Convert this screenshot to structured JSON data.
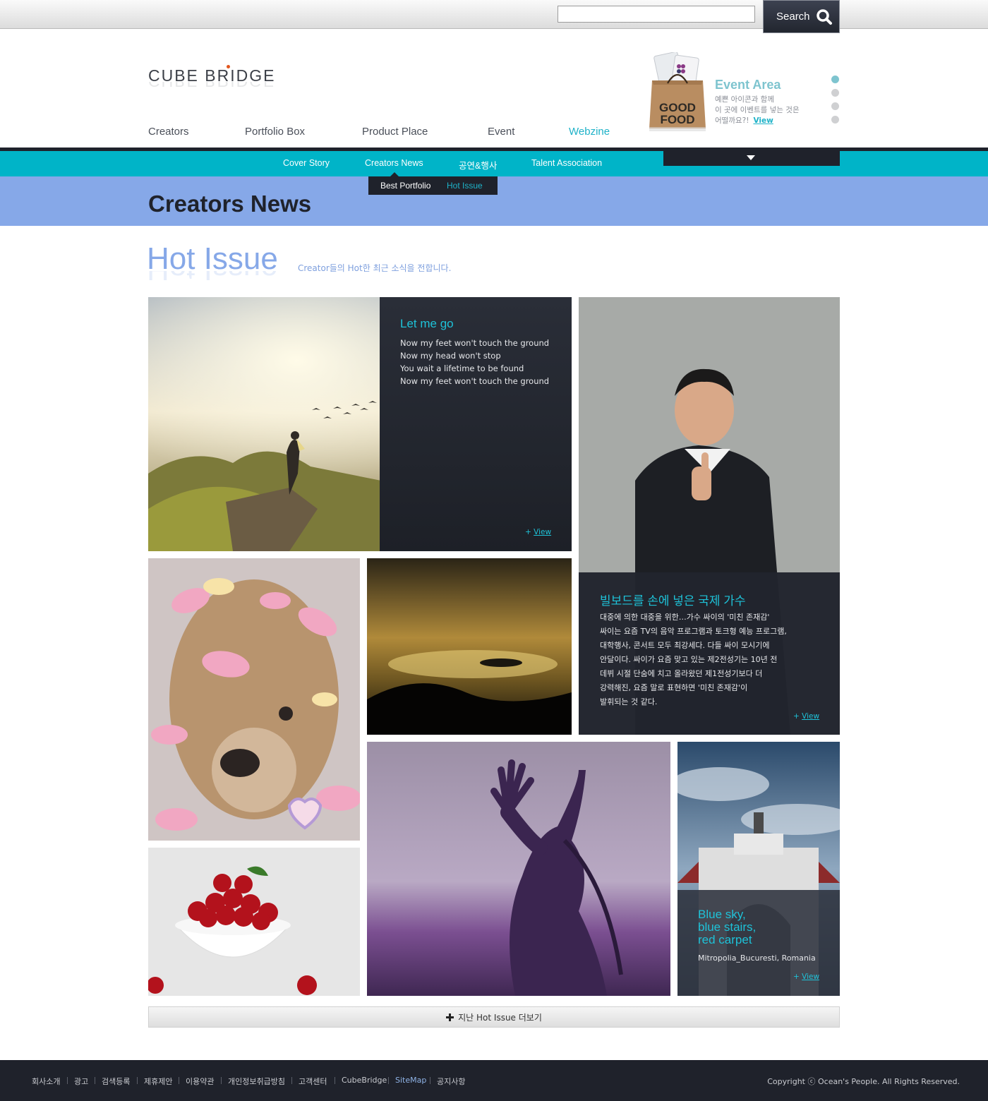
{
  "search": {
    "placeholder": "",
    "value": "",
    "button_label": "Search"
  },
  "brand": {
    "logo_text": "CUBE BRIDGE",
    "accent": "#1eb2c8",
    "title_band": "#86a8e8",
    "dark": "#1f222b"
  },
  "nav": {
    "items": [
      {
        "label": "Creators"
      },
      {
        "label": "Portfolio Box"
      },
      {
        "label": "Product Place"
      },
      {
        "label": "Event"
      },
      {
        "label": "Webzine",
        "active": true
      }
    ]
  },
  "event": {
    "title": "Event Area",
    "line1": "예쁜 아이콘과 함께",
    "line2": "이 곳에 이벤트를 넣는 것은",
    "line3": "어떨까요?!",
    "view_label": "View",
    "bag_text_1": "GOOD",
    "bag_text_2": "FOOD",
    "slide_count": 4,
    "active_slide": 1
  },
  "subnav": {
    "items": [
      {
        "label": "Cover Story"
      },
      {
        "label": "Creators News",
        "active": true
      },
      {
        "label": "공연&행사"
      },
      {
        "label": "Talent Association"
      }
    ],
    "tertiary": [
      {
        "label": "Best Portfolio"
      },
      {
        "label": "Hot Issue",
        "active": true
      }
    ]
  },
  "page": {
    "title": "Creators News"
  },
  "section": {
    "title": "Hot Issue",
    "subtitle": "Creator들의 Hot한 최근 소식을 전합니다."
  },
  "tiles": {
    "letmego": {
      "title": "Let me go",
      "lines": [
        "Now my feet won't touch the ground",
        "Now my head won't stop",
        "You wait a lifetime to be found",
        "Now my feet won't touch the ground"
      ],
      "view_prefix": "+",
      "view_label": "View"
    },
    "singer": {
      "title": "빌보드를 손에 넣은 국제 가수",
      "lines": [
        "대중에 의한 대중을 위한…가수 싸이의 '미친 존재감'",
        "싸이는 요즘 TV의 음악 프로그램과 토크형 예능 프로그램,",
        "대학행사, 콘서트 모두 최강세다. 다들 싸이 모시기에",
        "안달이다. 싸이가 요즘 맞고 있는 제2전성기는 10년 전",
        "데뷔 시절 단숨에 치고 올라왔던 제1전성기보다 더",
        "강력해진, 요즘 말로 표현하면 '미친 존재감'이",
        "발휘되는 것 같다."
      ],
      "view_prefix": "+",
      "view_label": "View"
    },
    "bluesky": {
      "title_lines": [
        "Blue sky,",
        "blue stairs,",
        "red carpet"
      ],
      "caption": "Mitropolia_Bucuresti, Romania",
      "view_prefix": "+",
      "view_label": "View"
    }
  },
  "more": {
    "label": "지난 Hot Issue 더보기"
  },
  "footer": {
    "links": [
      {
        "label": "회사소개"
      },
      {
        "label": "광고"
      },
      {
        "label": "검색등록"
      },
      {
        "label": "제휴제안"
      },
      {
        "label": "이용약관"
      },
      {
        "label": "개인정보취급방침"
      },
      {
        "label": "고객센터"
      },
      {
        "label": "CubeBridge"
      },
      {
        "label": "SiteMap",
        "alt": true
      },
      {
        "label": "공지사항"
      }
    ],
    "copyright": "Copyright ⓒ Ocean's People. All Rights Reserved."
  }
}
